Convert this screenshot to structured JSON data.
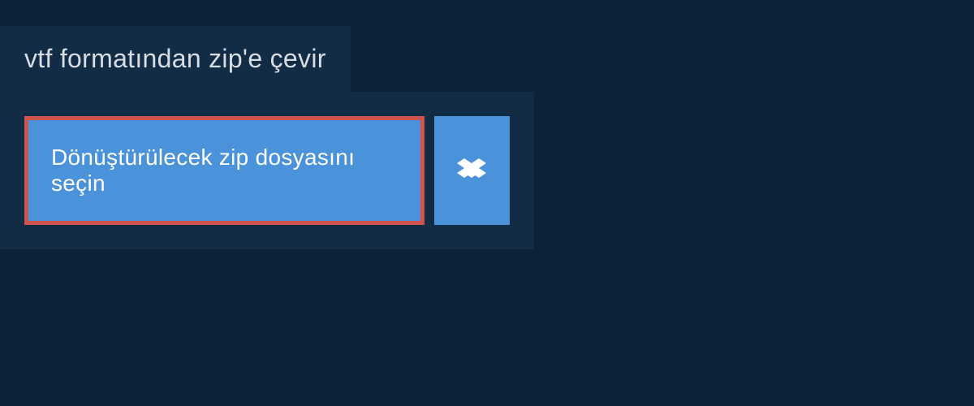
{
  "tab": {
    "title": "vtf formatından zip'e çevir"
  },
  "actions": {
    "choose_label": "Dönüştürülecek zip dosyasını seçin"
  }
}
